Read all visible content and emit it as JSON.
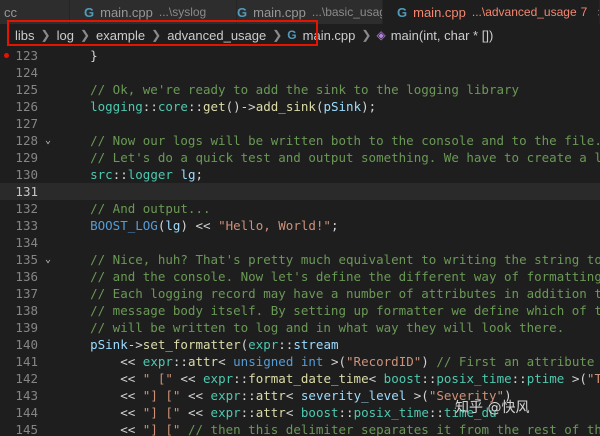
{
  "tabs": [
    {
      "name": "cc",
      "path": ""
    },
    {
      "name": "main.cpp",
      "path": "...\\syslog"
    },
    {
      "name": "main.cpp",
      "path": "...\\basic_usage"
    },
    {
      "name": "main.cpp",
      "path": "...\\advanced_usage",
      "badge": "7",
      "active": true
    }
  ],
  "close_glyph": "×",
  "breadcrumb": [
    "libs",
    "log",
    "example",
    "advanced_usage",
    "main.cpp",
    "main(int, char * [])"
  ],
  "lines": [
    {
      "num": "123",
      "tokens": [
        [
          "pun",
          "    }"
        ]
      ]
    },
    {
      "num": "124",
      "tokens": []
    },
    {
      "num": "125",
      "tokens": [
        [
          "com",
          "    // Ok, we're ready to add the sink to the logging library"
        ]
      ]
    },
    {
      "num": "126",
      "tokens": [
        [
          "ns",
          "    logging"
        ],
        [
          "pun",
          "::"
        ],
        [
          "ns",
          "core"
        ],
        [
          "pun",
          "::"
        ],
        [
          "fn",
          "get"
        ],
        [
          "pun",
          "()->"
        ],
        [
          "fn",
          "add_sink"
        ],
        [
          "pun",
          "("
        ],
        [
          "var",
          "pSink"
        ],
        [
          "pun",
          ");"
        ]
      ]
    },
    {
      "num": "127",
      "tokens": []
    },
    {
      "num": "128",
      "tokens": [
        [
          "com",
          "    // Now our logs will be written both to the console and to the file."
        ]
      ]
    },
    {
      "num": "129",
      "tokens": [
        [
          "com",
          "    // Let's do a quick test and output something. We have to create a logger f"
        ]
      ]
    },
    {
      "num": "130",
      "tokens": [
        [
          "ns",
          "    src"
        ],
        [
          "pun",
          "::"
        ],
        [
          "ns",
          "logger"
        ],
        [
          "pun",
          " "
        ],
        [
          "var",
          "lg"
        ],
        [
          "pun",
          ";"
        ]
      ]
    },
    {
      "num": "131",
      "tokens": []
    },
    {
      "num": "132",
      "tokens": [
        [
          "com",
          "    // And output..."
        ]
      ]
    },
    {
      "num": "133",
      "tokens": [
        [
          "kw",
          "    BOOST_LOG"
        ],
        [
          "pun",
          "("
        ],
        [
          "var",
          "lg"
        ],
        [
          "pun",
          ") << "
        ],
        [
          "str",
          "\"Hello, World!\""
        ],
        [
          "pun",
          ";"
        ]
      ]
    },
    {
      "num": "134",
      "tokens": []
    },
    {
      "num": "135",
      "tokens": [
        [
          "com",
          "    // Nice, huh? That's pretty much equivalent to writing the string to both t"
        ]
      ]
    },
    {
      "num": "136",
      "tokens": [
        [
          "com",
          "    // and the console. Now let's define the different way of formatting log re"
        ]
      ]
    },
    {
      "num": "137",
      "tokens": [
        [
          "com",
          "    // Each logging record may have a number of attributes in addition to the"
        ]
      ]
    },
    {
      "num": "138",
      "tokens": [
        [
          "com",
          "    // message body itself. By setting up formatter we define which of them"
        ]
      ]
    },
    {
      "num": "139",
      "tokens": [
        [
          "com",
          "    // will be written to log and in what way they will look there."
        ]
      ]
    },
    {
      "num": "140",
      "tokens": [
        [
          "var",
          "    pSink"
        ],
        [
          "pun",
          "->"
        ],
        [
          "fn",
          "set_formatter"
        ],
        [
          "pun",
          "("
        ],
        [
          "ns",
          "expr"
        ],
        [
          "pun",
          "::"
        ],
        [
          "var",
          "stream"
        ]
      ]
    },
    {
      "num": "141",
      "tokens": [
        [
          "pun",
          "        << "
        ],
        [
          "ns",
          "expr"
        ],
        [
          "pun",
          "::"
        ],
        [
          "fn",
          "attr"
        ],
        [
          "pun",
          "< "
        ],
        [
          "kw",
          "unsigned int"
        ],
        [
          "pun",
          " >("
        ],
        [
          "str",
          "\"RecordID\""
        ],
        [
          "pun",
          ") "
        ],
        [
          "com",
          "// First an attribute \"Record"
        ]
      ]
    },
    {
      "num": "142",
      "tokens": [
        [
          "pun",
          "        << "
        ],
        [
          "str",
          "\" [\""
        ],
        [
          "pun",
          " << "
        ],
        [
          "ns",
          "expr"
        ],
        [
          "pun",
          "::"
        ],
        [
          "fn",
          "format_date_time"
        ],
        [
          "pun",
          "< "
        ],
        [
          "ns",
          "boost"
        ],
        [
          "pun",
          "::"
        ],
        [
          "ns",
          "posix_time"
        ],
        [
          "pun",
          "::"
        ],
        [
          "ns",
          "ptime"
        ],
        [
          "pun",
          " >("
        ],
        [
          "str",
          "\"TimeStam"
        ]
      ]
    },
    {
      "num": "143",
      "tokens": [
        [
          "pun",
          "        << "
        ],
        [
          "str",
          "\"] [\""
        ],
        [
          "pun",
          " << "
        ],
        [
          "ns",
          "expr"
        ],
        [
          "pun",
          "::"
        ],
        [
          "fn",
          "attr"
        ],
        [
          "pun",
          "< "
        ],
        [
          "var",
          "severity_level"
        ],
        [
          "pun",
          " >("
        ],
        [
          "str",
          "\"Severity\""
        ],
        [
          "pun",
          ")"
        ]
      ]
    },
    {
      "num": "144",
      "tokens": [
        [
          "pun",
          "        << "
        ],
        [
          "str",
          "\"] [\""
        ],
        [
          "pun",
          " << "
        ],
        [
          "ns",
          "expr"
        ],
        [
          "pun",
          "::"
        ],
        [
          "fn",
          "attr"
        ],
        [
          "pun",
          "< "
        ],
        [
          "ns",
          "boost"
        ],
        [
          "pun",
          "::"
        ],
        [
          "ns",
          "posix_time"
        ],
        [
          "pun",
          "::"
        ],
        [
          "ns",
          "time_du"
        ]
      ]
    },
    {
      "num": "145",
      "tokens": [
        [
          "pun",
          "        << "
        ],
        [
          "str",
          "\"] [\""
        ],
        [
          "pun",
          " "
        ],
        [
          "com",
          "// then this delimiter separates it from the rest of the line"
        ]
      ]
    }
  ],
  "watermark": "知乎 @快风"
}
